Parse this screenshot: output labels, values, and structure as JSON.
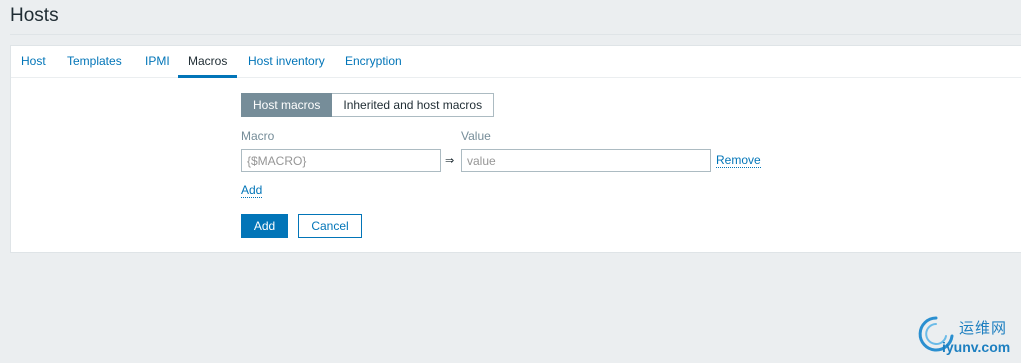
{
  "page": {
    "title": "Hosts"
  },
  "tabs": [
    {
      "label": "Host"
    },
    {
      "label": "Templates"
    },
    {
      "label": "IPMI"
    },
    {
      "label": "Macros",
      "active": true
    },
    {
      "label": "Host inventory"
    },
    {
      "label": "Encryption"
    }
  ],
  "macro_view": {
    "options": [
      "Host macros",
      "Inherited and host macros"
    ],
    "selected": "Host macros"
  },
  "macros_table": {
    "macro_header": "Macro",
    "value_header": "Value",
    "rows": [
      {
        "macro_placeholder": "{$MACRO}",
        "macro_value": "",
        "arrow": "⇒",
        "value_placeholder": "value",
        "value_value": "",
        "remove_label": "Remove"
      }
    ],
    "add_link_label": "Add"
  },
  "actions": {
    "add_label": "Add",
    "cancel_label": "Cancel"
  },
  "watermark": {
    "line1": "运维网",
    "line2": "iyunv.com"
  },
  "colors": {
    "accent": "#0275b8",
    "background": "#ebeef0",
    "segment_active": "#768d99"
  }
}
